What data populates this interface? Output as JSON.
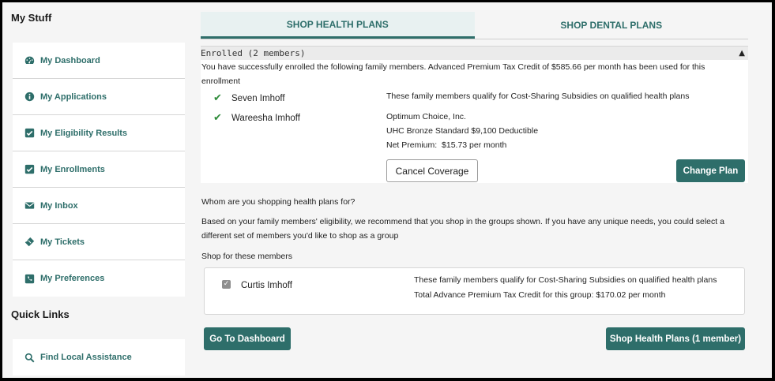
{
  "sidebar": {
    "my_stuff_title": "My Stuff",
    "items": [
      {
        "label": "My Dashboard",
        "icon": "dashboard-icon"
      },
      {
        "label": "My Applications",
        "icon": "info-icon"
      },
      {
        "label": "My Eligibility Results",
        "icon": "checkbox-icon"
      },
      {
        "label": "My Enrollments",
        "icon": "checkbox-icon"
      },
      {
        "label": "My Inbox",
        "icon": "envelope-icon"
      },
      {
        "label": "My Tickets",
        "icon": "ticket-icon"
      },
      {
        "label": "My Preferences",
        "icon": "phone-icon"
      }
    ],
    "quick_links_title": "Quick Links",
    "quick_links": [
      {
        "label": "Find Local Assistance",
        "icon": "search-icon"
      }
    ]
  },
  "tabs": [
    {
      "label": "SHOP HEALTH PLANS",
      "active": true
    },
    {
      "label": "SHOP DENTAL PLANS",
      "active": false
    }
  ],
  "enrolled": {
    "header": "Enrolled (2 members)",
    "message_line1": "You have successfully enrolled the following family members. Advanced Premium Tax Credit of $585.66 per month has been used for this",
    "message_line2": "enrollment",
    "members": [
      "Seven Imhoff",
      "Wareesha Imhoff"
    ],
    "subsidy_note": "These family members qualify for Cost-Sharing Subsidies on qualified health plans",
    "carrier": "Optimum Choice, Inc.",
    "plan": "UHC Bronze Standard $9,100 Deductible",
    "net_premium": "Net Premium:  $15.73 per month",
    "cancel_label": "Cancel Coverage",
    "change_label": "Change Plan"
  },
  "shopping": {
    "question": "Whom are you shopping health plans for?",
    "recommend_line1": "Based on your family members' eligibility, we recommend that you shop in the groups shown. If you have any unique needs, you could select a",
    "recommend_line2": "different set of members you'd like to shop as a group",
    "shop_for_label": "Shop for these members",
    "group": {
      "member": "Curtis Imhoff",
      "checked": true,
      "subsidy_note": "These family members qualify for Cost-Sharing Subsidies on qualified health plans",
      "tax_credit": "Total Advance Premium Tax Credit for this group: $170.02 per month"
    }
  },
  "actions": {
    "dashboard_label": "Go To Dashboard",
    "shop_label": "Shop Health Plans (1 member)"
  },
  "colors": {
    "accent": "#2e6e6a",
    "check": "#2e8b3a"
  }
}
